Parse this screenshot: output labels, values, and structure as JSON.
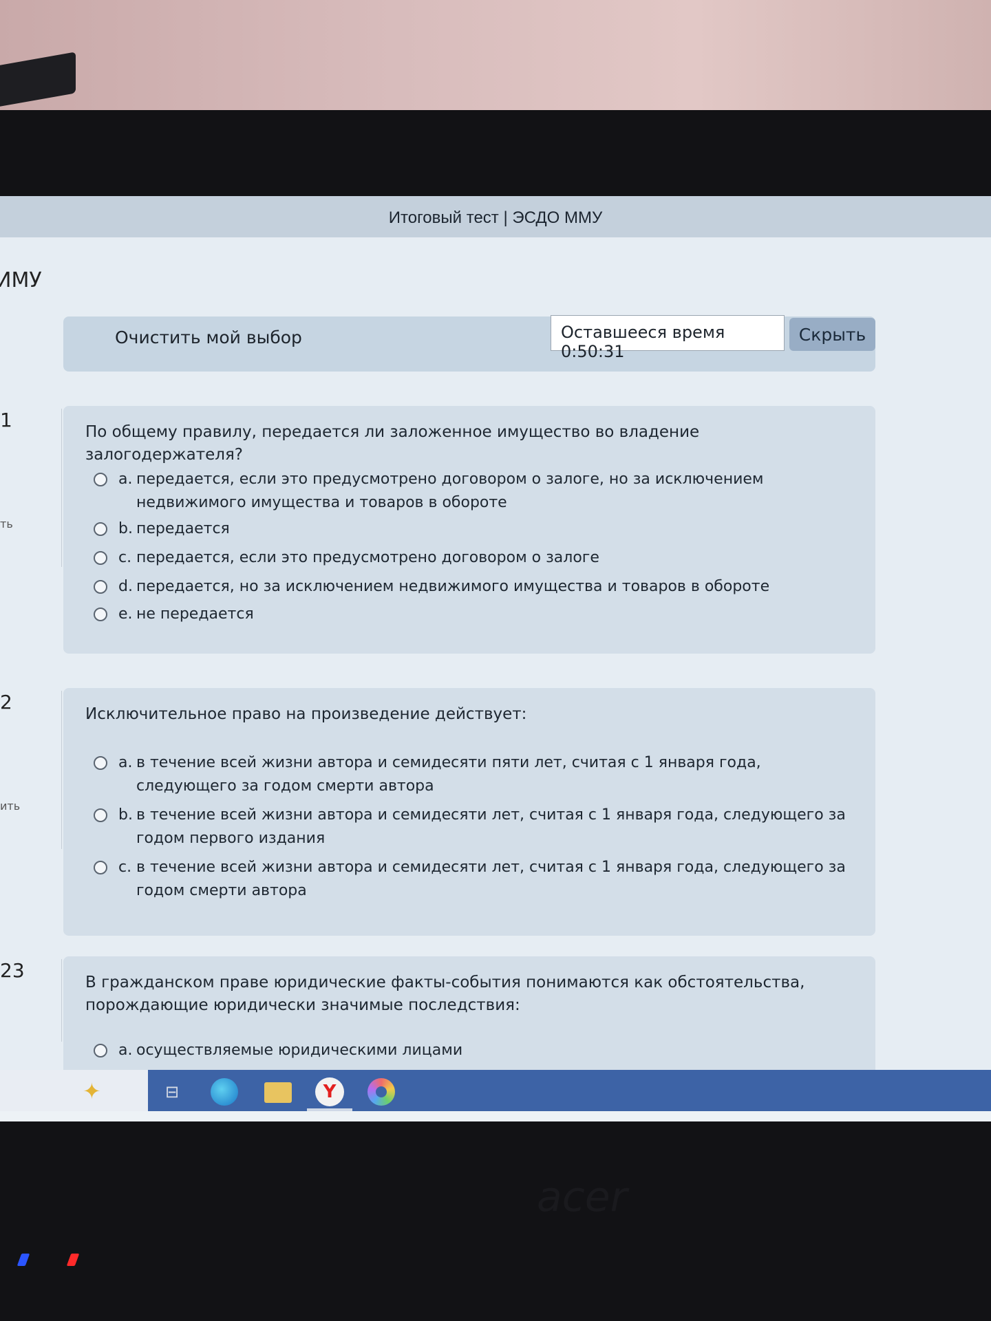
{
  "window": {
    "title": "Итоговый тест | ЭСДО ММУ"
  },
  "site": {
    "name_fragment": "ИМУ"
  },
  "toolbar": {
    "clear_label": "Очистить мой выбор",
    "timer_label": "Оставшееся время 0:50:31",
    "hide_label": "Скрыть"
  },
  "questions": [
    {
      "number": "1",
      "flag_fragment": "ть",
      "text": "По общему правилу, передается ли заложенное имущество во владение залогодержателя?",
      "answers": [
        {
          "letter": "a.",
          "text": "передается, если это предусмотрено договором о залоге, но за исключением недвижимого имущества и товаров в обороте"
        },
        {
          "letter": "b.",
          "text": "передается"
        },
        {
          "letter": "c.",
          "text": "передается, если это предусмотрено договором о залоге"
        },
        {
          "letter": "d.",
          "text": "передается, но за исключением недвижимого имущества и товаров в обороте"
        },
        {
          "letter": "e.",
          "text": "не передается"
        }
      ]
    },
    {
      "number": "2",
      "flag_fragment": "ить",
      "text": "Исключительное право на произведение действует:",
      "answers": [
        {
          "letter": "a.",
          "text": "в течение всей жизни автора и семидесяти пяти лет, считая с 1 января года, следующего за годом смерти автора"
        },
        {
          "letter": "b.",
          "text": "в течение всей жизни автора и семидесяти лет, считая с 1 января года, следующего за годом первого издания"
        },
        {
          "letter": "c.",
          "text": "в течение всей жизни автора и семидесяти лет, считая с 1 января года, следующего за годом смерти автора"
        }
      ]
    },
    {
      "number": "23",
      "text": "В гражданском праве юридические факты-события понимаются как обстоятельства, порождающие юридически значимые последствия:",
      "answers": [
        {
          "letter": "a.",
          "text": "осуществляемые юридическими лицами"
        }
      ]
    }
  ],
  "taskbar": {
    "icons": [
      "copilot-icon",
      "task-view-icon",
      "edge-icon",
      "file-explorer-icon",
      "yandex-browser-icon",
      "photos-icon"
    ],
    "yandex_glyph": "Y",
    "taskview_glyph": "⊟"
  },
  "laptop": {
    "brand": "acer"
  },
  "colors": {
    "page_bg": "#e6edf3",
    "question_bg": "#d3dee8",
    "toolbar_bg": "#c6d5e2",
    "hide_button": "#98adc5",
    "taskbar": "#3d63a6"
  }
}
